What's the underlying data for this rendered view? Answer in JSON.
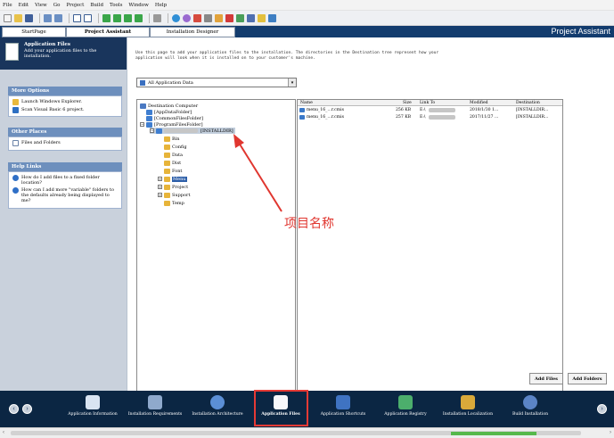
{
  "menu": [
    "File",
    "Edit",
    "View",
    "Go",
    "Project",
    "Build",
    "Tools",
    "Window",
    "Help"
  ],
  "tabs": {
    "start_page": "StartPage",
    "project_assistant": "Project Assistant",
    "installation_designer": "Installation Designer",
    "header_title": "Project Assistant"
  },
  "sidebar": {
    "header_title": "Application Files",
    "header_desc": "Add your application files to the installation.",
    "more_options": {
      "title": "More Options",
      "items": [
        "Launch Windows Explorer.",
        "Scan Visual Basic 6 project."
      ]
    },
    "other_places": {
      "title": "Other Places",
      "items": [
        "Files and Folders"
      ]
    },
    "help_links": {
      "title": "Help Links",
      "items": [
        "How do I add files to a fixed folder location?",
        "How can I add more \"variable\" folders to the defaults already being displayed to me?"
      ]
    }
  },
  "main": {
    "description": "Use this page to add your application files to the installation. The directories in the Destination tree represent how your application will look when it is installed on to your customer's machine.",
    "dropdown_value": "All Application Data",
    "tree": {
      "root": "Destination Computer",
      "nodes": [
        "[AppDataFolder]",
        "[CommonFilesFolder]",
        "[ProgramFilesFolder]",
        "[INSTALLDIR]",
        "Bin",
        "Config",
        "Data",
        "Dist",
        "Font",
        "Menu",
        "Project",
        "Support",
        "Temp"
      ]
    },
    "filelist": {
      "columns": [
        "Name",
        "Size",
        "Link To",
        "Modified",
        "Destination"
      ],
      "rows": [
        {
          "name": "menu_16_…r.cmis",
          "size": "256 KB",
          "link": "E:\\",
          "modified": "2018/1/30 1...",
          "dest": "[INSTALLDIR..."
        },
        {
          "name": "menu_16_…r.cmis",
          "size": "257 KB",
          "link": "E:\\",
          "modified": "2017/11/27 ...",
          "dest": "[INSTALLDIR..."
        }
      ]
    },
    "buttons": {
      "add_files": "Add Files",
      "add_folders": "Add Folders"
    }
  },
  "bottom_steps": [
    {
      "label": "Application Information"
    },
    {
      "label": "Installation Requirements"
    },
    {
      "label": "Installation Architecture"
    },
    {
      "label": "Application Files"
    },
    {
      "label": "Application Shortcuts"
    },
    {
      "label": "Application Registry"
    },
    {
      "label": "Installation Localization"
    },
    {
      "label": "Build Installation"
    }
  ],
  "annotation": {
    "text": "项目名称",
    "color": "#e0362f"
  }
}
